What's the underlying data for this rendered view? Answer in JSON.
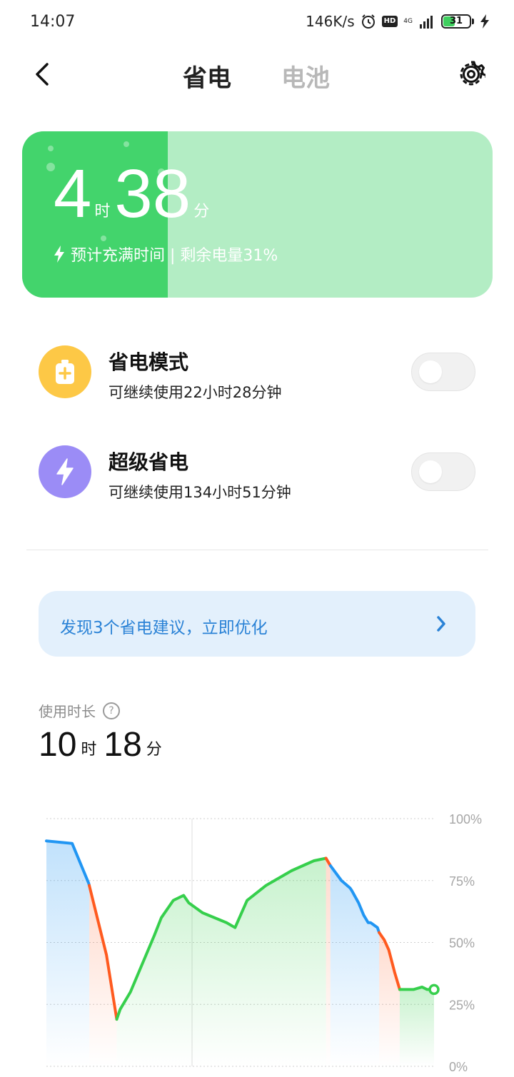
{
  "status_bar": {
    "time": "14:07",
    "network_speed": "146K/s",
    "hd_badge": "HD",
    "network_type": "4G",
    "battery_level": "31",
    "icons": [
      "alarm-icon",
      "signal-icon",
      "battery-icon",
      "charging-icon"
    ]
  },
  "header": {
    "back_icon": "chevron-left-icon",
    "tabs": [
      {
        "label": "省电",
        "active": true
      },
      {
        "label": "电池",
        "active": false
      }
    ],
    "settings_icon": "gear-icon"
  },
  "battery_card": {
    "hours": "4",
    "hours_unit": "时",
    "minutes": "38",
    "minutes_unit": "分",
    "subtitle": "预计充满时间 | 剩余电量31%",
    "charge_fraction": 0.31,
    "colors": {
      "fill": "#43d46c",
      "background": "#b3edc4"
    }
  },
  "modes": [
    {
      "title": "省电模式",
      "subtitle": "可继续使用22小时28分钟",
      "icon": "battery-plus-icon",
      "color": "#fdc846",
      "enabled": false
    },
    {
      "title": "超级省电",
      "subtitle": "可继续使用134小时51分钟",
      "icon": "lightning-icon",
      "color": "#9b8cf6",
      "enabled": false
    }
  ],
  "suggestion": {
    "text": "发现3个省电建议，立即优化",
    "icon": "chevron-right-icon"
  },
  "usage": {
    "label": "使用时长",
    "help_icon": "?",
    "hours": "10",
    "hours_unit": "时",
    "minutes": "18",
    "minutes_unit": "分"
  },
  "chart_data": {
    "type": "line",
    "title": "",
    "xlabel": "",
    "ylabel": "",
    "ylim": [
      0,
      100
    ],
    "y_ticks": [
      "100%",
      "75%",
      "50%",
      "25%",
      "0%"
    ],
    "grid": true,
    "series_colors": {
      "discharging": "#2196f3",
      "heavy_discharge": "#ff5a1f",
      "charging": "#36cf4c"
    },
    "segments": [
      {
        "state": "discharging",
        "x": [
          0,
          7.5,
          12.3,
          12.5
        ],
        "y": [
          91,
          90,
          74,
          73
        ]
      },
      {
        "state": "heavy_discharge",
        "x": [
          12.5,
          17.5,
          20.5
        ],
        "y": [
          73,
          45,
          19
        ]
      },
      {
        "state": "charging",
        "x": [
          20.5,
          21.5,
          24.5,
          31.5,
          33.5,
          37,
          40,
          41.5,
          45.5,
          52.5,
          55,
          58.5,
          64,
          71.5,
          78,
          81.5
        ],
        "y": [
          19,
          23,
          30,
          53,
          60,
          67,
          69,
          66,
          62,
          58,
          56,
          67,
          73,
          79,
          83,
          84
        ]
      },
      {
        "state": "heavy_discharge",
        "x": [
          81.5,
          82.8
        ],
        "y": [
          84,
          81
        ]
      },
      {
        "state": "discharging",
        "x": [
          82.8,
          86,
          88.5,
          89,
          91,
          92.5,
          93.8,
          94.5,
          96.5,
          97
        ],
        "y": [
          81,
          75,
          72,
          71,
          66,
          61,
          58,
          58,
          56,
          54
        ]
      },
      {
        "state": "heavy_discharge",
        "x": [
          97,
          98.5,
          99.8,
          101.5,
          103
        ],
        "y": [
          54,
          51,
          47,
          38,
          31
        ]
      },
      {
        "state": "charging",
        "x": [
          103,
          107,
          109.5,
          111,
          113
        ],
        "y": [
          31,
          31,
          32,
          31,
          31
        ]
      }
    ],
    "current_point": {
      "x": 113,
      "y": 31
    }
  }
}
